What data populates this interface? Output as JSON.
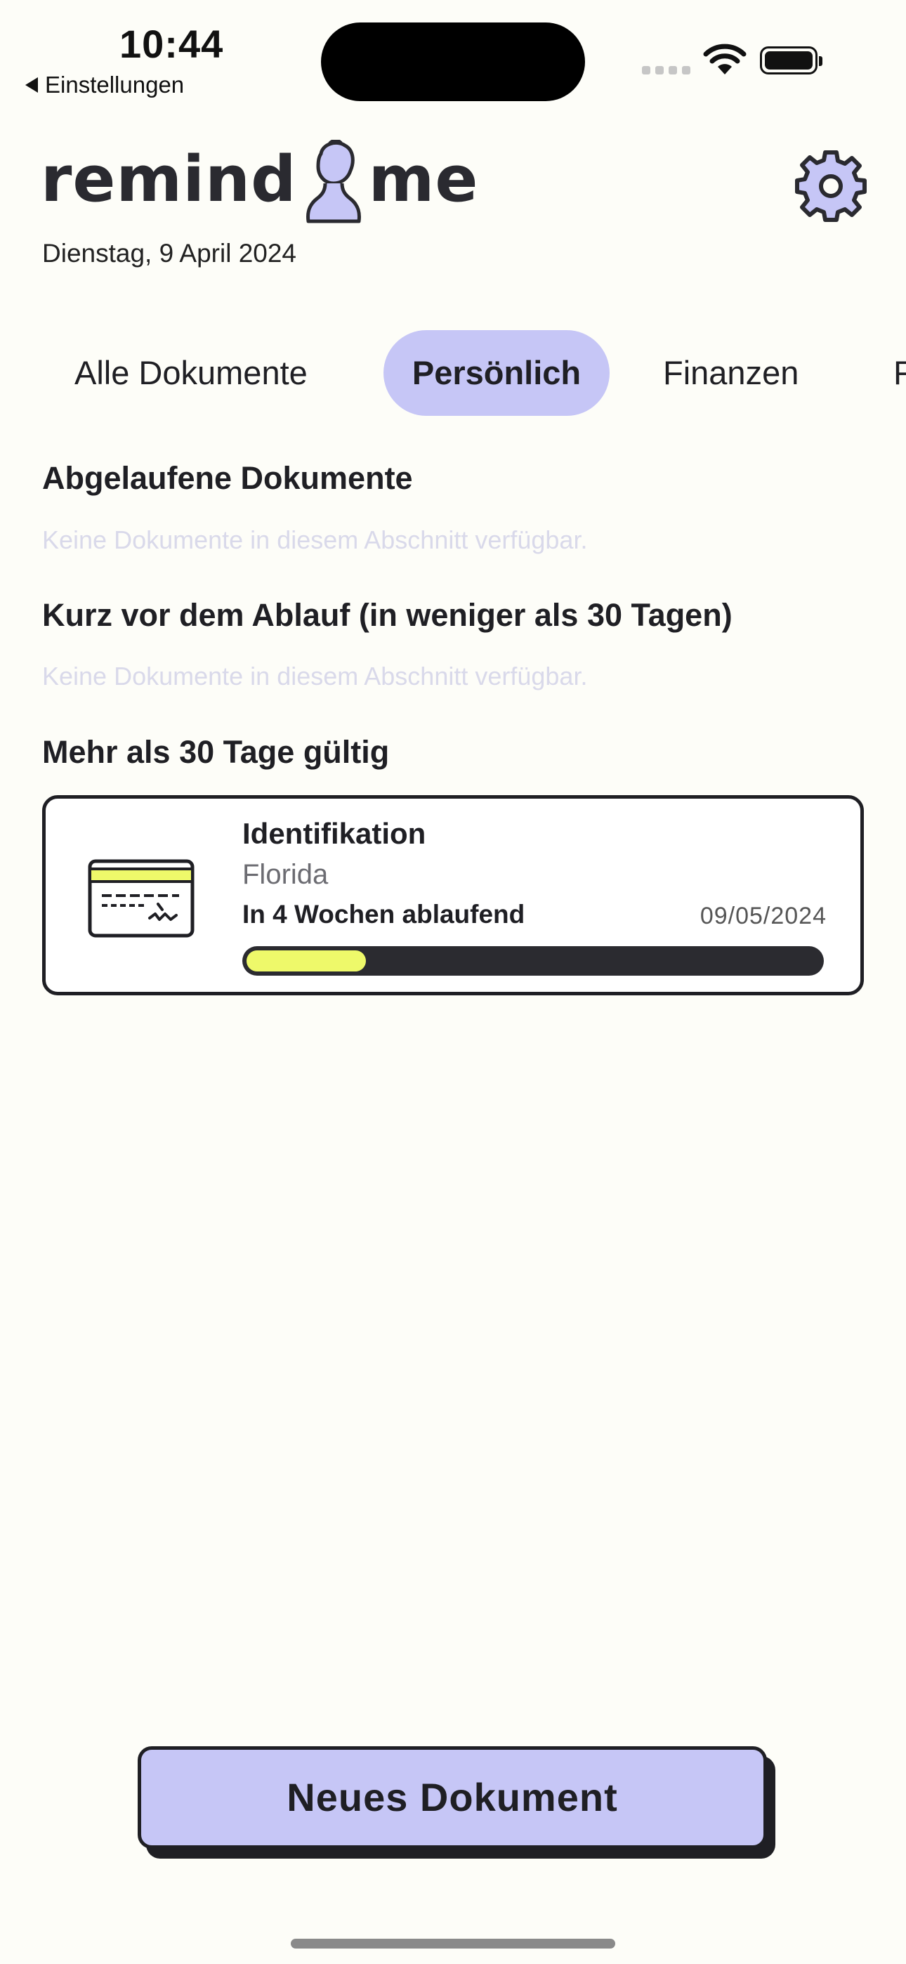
{
  "status_bar": {
    "time": "10:44",
    "back_label": "Einstellungen"
  },
  "header": {
    "logo_left": "remind",
    "logo_right": "me",
    "date": "Dienstag, 9 April 2024"
  },
  "tabs": [
    {
      "label": "Alle Dokumente",
      "active": false
    },
    {
      "label": "Persönlich",
      "active": true
    },
    {
      "label": "Finanzen",
      "active": false
    },
    {
      "label": "F",
      "active": false
    }
  ],
  "sections": {
    "expired": {
      "title": "Abgelaufene Dokumente",
      "empty_text": "Keine Dokumente in diesem Abschnitt verfügbar."
    },
    "expiring_soon": {
      "title": "Kurz vor dem Ablauf (in weniger als 30 Tagen)",
      "empty_text": "Keine Dokumente in diesem Abschnitt verfügbar."
    },
    "valid": {
      "title": "Mehr als 30 Tage gültig"
    }
  },
  "documents": [
    {
      "title": "Identifikation",
      "subtitle": "Florida",
      "status": "In 4 Wochen ablaufend",
      "date": "09/05/2024",
      "progress": 0.22,
      "icon": "id-card-icon"
    }
  ],
  "actions": {
    "new_document": "Neues Dokument"
  },
  "colors": {
    "accent": "#c6c6f6",
    "progress_fill": "#eef96a",
    "progress_track": "#2b2b30",
    "text": "#1f1f24",
    "background": "#fdfdf8"
  }
}
